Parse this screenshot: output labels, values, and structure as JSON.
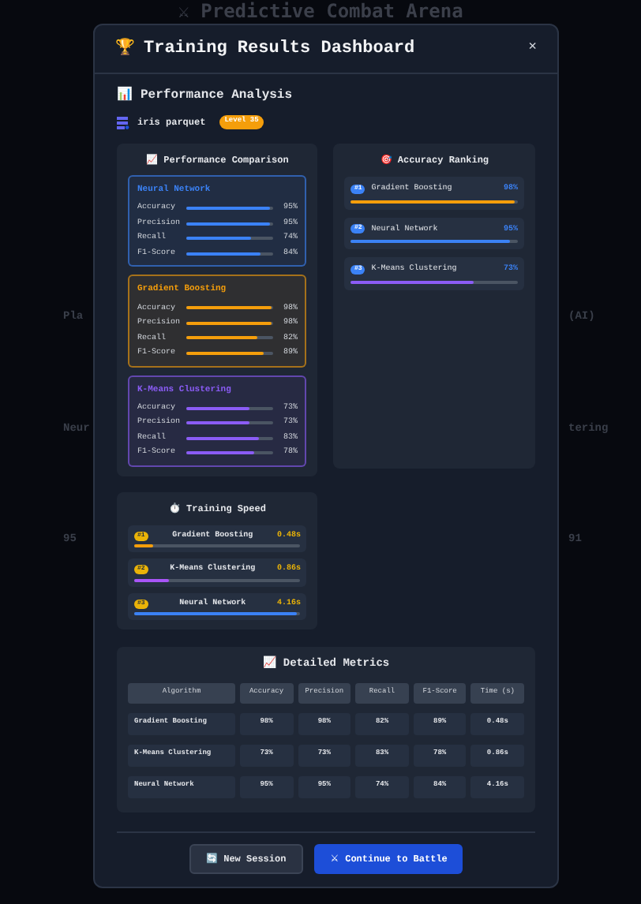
{
  "background": {
    "title": "⚔ Predictive Combat Arena",
    "left_fragments": [
      "Pla",
      "Neur",
      "95"
    ],
    "right_fragments": [
      "(AI)",
      "tering",
      "91"
    ]
  },
  "modal": {
    "icon": "🏆",
    "title": "Training Results Dashboard",
    "close": "×"
  },
  "section": {
    "icon": "📊",
    "title": "Performance Analysis"
  },
  "dataset": {
    "name": "iris parquet",
    "badge": "Level 35"
  },
  "comparison": {
    "icon": "📈",
    "title": "Performance Comparison",
    "models": [
      {
        "name": "Neural Network",
        "color": "#3b82f6",
        "metrics": [
          {
            "label": "Accuracy",
            "level": 0.95,
            "value": "95%"
          },
          {
            "label": "Precision",
            "level": 0.95,
            "value": "95%"
          },
          {
            "label": "Recall",
            "level": 0.74,
            "value": "74%"
          },
          {
            "label": "F1-Score",
            "level": 0.84,
            "value": "84%"
          }
        ]
      },
      {
        "name": "Gradient Boosting",
        "color": "#f59e0b",
        "metrics": [
          {
            "label": "Accuracy",
            "level": 0.98,
            "value": "98%"
          },
          {
            "label": "Precision",
            "level": 0.98,
            "value": "98%"
          },
          {
            "label": "Recall",
            "level": 0.82,
            "value": "82%"
          },
          {
            "label": "F1-Score",
            "level": 0.89,
            "value": "89%"
          }
        ]
      },
      {
        "name": "K-Means Clustering",
        "color": "#8b5cf6",
        "metrics": [
          {
            "label": "Accuracy",
            "level": 0.73,
            "value": "73%"
          },
          {
            "label": "Precision",
            "level": 0.73,
            "value": "73%"
          },
          {
            "label": "Recall",
            "level": 0.83,
            "value": "83%"
          },
          {
            "label": "F1-Score",
            "level": 0.78,
            "value": "78%"
          }
        ]
      }
    ]
  },
  "ranking": {
    "icon": "🎯",
    "title": "Accuracy Ranking",
    "items": [
      {
        "rank": "#1",
        "name": "Gradient Boosting",
        "value": "98%",
        "level": 0.98,
        "color": "#f59e0b"
      },
      {
        "rank": "#2",
        "name": "Neural Network",
        "value": "95%",
        "level": 0.95,
        "color": "#3b82f6"
      },
      {
        "rank": "#3",
        "name": "K-Means Clustering",
        "value": "73%",
        "level": 0.73,
        "color": "#8b5cf6"
      }
    ]
  },
  "speed": {
    "icon": "⏱️",
    "title": "Training Speed",
    "items": [
      {
        "rank": "#1",
        "name": "Gradient Boosting",
        "value": "0.48s",
        "level": 0.11,
        "color": "#f59e0b"
      },
      {
        "rank": "#2",
        "name": "K-Means Clustering",
        "value": "0.86s",
        "level": 0.21,
        "color": "#a855f7"
      },
      {
        "rank": "#3",
        "name": "Neural Network",
        "value": "4.16s",
        "level": 0.98,
        "color": "#3b82f6"
      }
    ]
  },
  "metrics": {
    "icon": "📈",
    "title": "Detailed Metrics",
    "columns": [
      "Algorithm",
      "Accuracy",
      "Precision",
      "Recall",
      "F1-Score",
      "Time (s)"
    ],
    "rows": [
      [
        "Gradient Boosting",
        "98%",
        "98%",
        "82%",
        "89%",
        "0.48s"
      ],
      [
        "K-Means Clustering",
        "73%",
        "73%",
        "83%",
        "78%",
        "0.86s"
      ],
      [
        "Neural Network",
        "95%",
        "95%",
        "74%",
        "84%",
        "4.16s"
      ]
    ]
  },
  "buttons": [
    {
      "kind": "secondary",
      "icon": "🔄",
      "label": "New Session"
    },
    {
      "kind": "primary",
      "icon": "⚔",
      "label": "Continue to Battle"
    }
  ]
}
